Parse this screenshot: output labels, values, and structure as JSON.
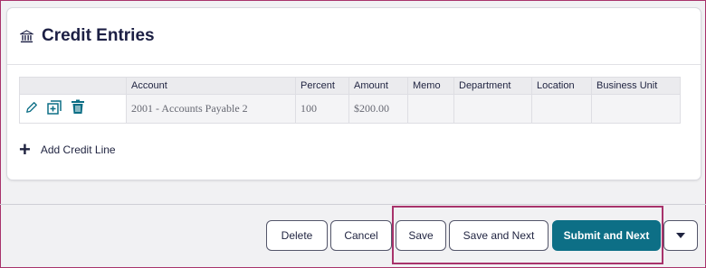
{
  "card": {
    "title": "Credit Entries"
  },
  "table": {
    "headers": [
      "",
      "Account",
      "Percent",
      "Amount",
      "Memo",
      "Department",
      "Location",
      "Business Unit"
    ],
    "rows": [
      {
        "account": "2001 - Accounts Payable 2",
        "percent": "100",
        "amount": "$200.00",
        "memo": "",
        "department": "",
        "location": "",
        "business_unit": ""
      }
    ]
  },
  "add_line_label": "Add Credit Line",
  "footer": {
    "delete_label": "Delete",
    "cancel_label": "Cancel",
    "save_label": "Save",
    "save_next_label": "Save and Next",
    "submit_next_label": "Submit and Next"
  },
  "icons": {
    "title": "bank-icon",
    "edit": "pencil-icon",
    "add_row": "plus-square-icon",
    "delete": "trash-icon",
    "add": "plus-icon",
    "more": "caret-down-icon"
  },
  "colors": {
    "accent": "#0d6f86",
    "highlight": "#a8336b",
    "title": "#1c1f44"
  }
}
